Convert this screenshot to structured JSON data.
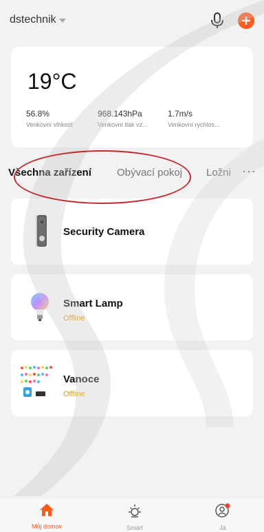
{
  "header": {
    "home_name": "dstechnik"
  },
  "weather": {
    "temperature": "19°C",
    "stats": [
      {
        "value": "56.8%",
        "label": "Venkovní vlhkost"
      },
      {
        "value": "968.143hPa",
        "label": "Venkovní tlak vz..."
      },
      {
        "value": "1.7m/s",
        "label": "Venkovní rychlos..."
      }
    ]
  },
  "tabs": {
    "items": [
      "Všechna zařízení",
      "Obývací pokoj",
      "Ložni"
    ],
    "more": "···"
  },
  "devices": [
    {
      "name": "Security Camera",
      "status": ""
    },
    {
      "name": "Smart Lamp",
      "status": "Offline"
    },
    {
      "name": "Vanoce",
      "status": "Offline"
    }
  ],
  "bottom_nav": {
    "items": [
      {
        "label": "Můj domov",
        "icon": "home-icon"
      },
      {
        "label": "Smart",
        "icon": "sun-icon"
      },
      {
        "label": "Já",
        "icon": "user-icon"
      }
    ]
  },
  "colors": {
    "accent": "#ff5a1f",
    "offline": "#e8a100",
    "highlight": "#c4282d"
  }
}
